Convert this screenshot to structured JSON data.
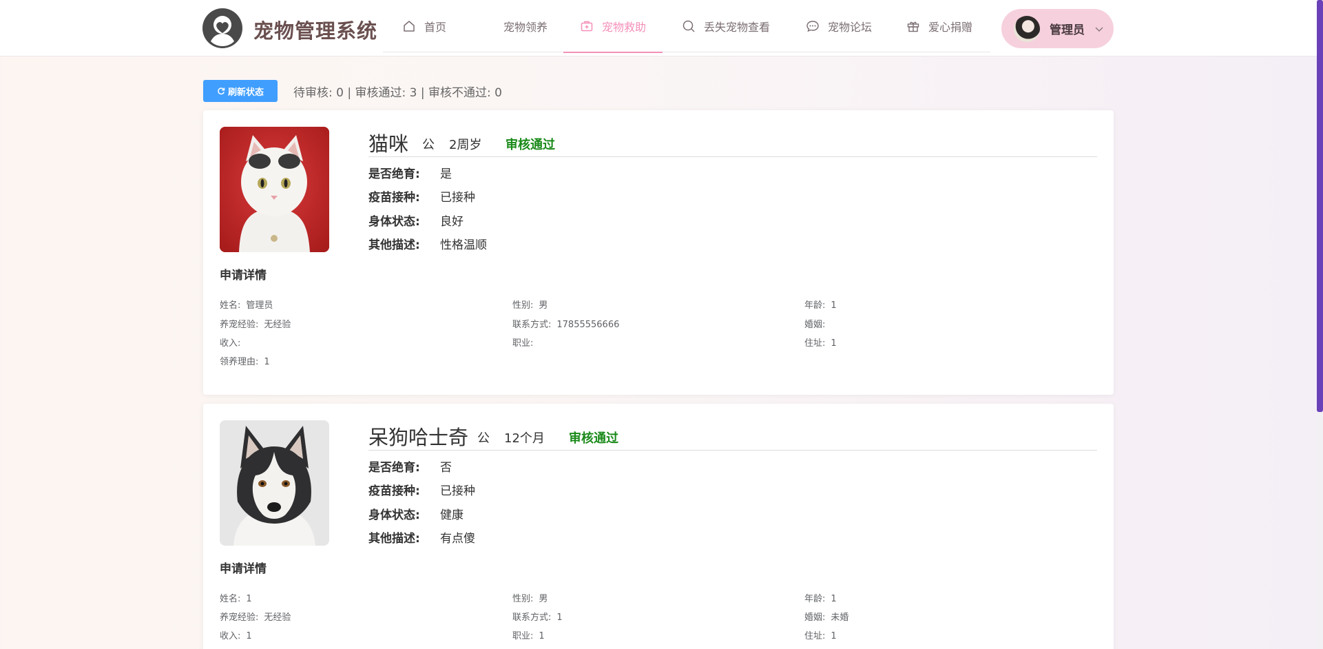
{
  "header": {
    "brand": "宠物管理系统",
    "nav": [
      {
        "label": "首页"
      },
      {
        "label": "宠物领养"
      },
      {
        "label": "宠物救助"
      },
      {
        "label": "丢失宠物查看"
      },
      {
        "label": "宠物论坛"
      },
      {
        "label": "爱心捐赠"
      }
    ],
    "active_nav": "宠物救助",
    "user_name": "管理员"
  },
  "toolbar": {
    "refresh_label": "刷新状态",
    "stats_text": "待审核: 0 | 审核通过: 3 | 审核不通过: 0"
  },
  "labels": {
    "sterilized": "是否绝育:",
    "vaccinated": "疫苗接种:",
    "health": "身体状态:",
    "other": "其他描述:",
    "apply_details": "申请详情",
    "name": "姓名:",
    "gender": "性别:",
    "age": "年龄:",
    "experience": "养宠经验:",
    "contact": "联系方式:",
    "marriage": "婚姻:",
    "income": "收入:",
    "job": "职业:",
    "address": "住址:",
    "reason": "领养理由:"
  },
  "cards": [
    {
      "pet_name": "猫咪",
      "sex": "公",
      "age": "2周岁",
      "status": "审核通过",
      "sterilized": "是",
      "vaccinated": "已接种",
      "health": "良好",
      "other": "性格温顺",
      "applicant": {
        "name": "管理员",
        "gender": "男",
        "age": "1",
        "experience": "无经验",
        "contact": "17855556666",
        "marriage": "",
        "income": "",
        "job": "",
        "address": "1",
        "reason": "1"
      }
    },
    {
      "pet_name": "呆狗哈士奇",
      "sex": "公",
      "age": "12个月",
      "status": "审核通过",
      "sterilized": "否",
      "vaccinated": "已接种",
      "health": "健康",
      "other": "有点傻",
      "applicant": {
        "name": "1",
        "gender": "男",
        "age": "1",
        "experience": "无经验",
        "contact": "1",
        "marriage": "未婚",
        "income": "1",
        "job": "1",
        "address": "1"
      }
    }
  ],
  "colors": {
    "accent_pink": "#f48fb8",
    "primary_blue": "#409eff",
    "status_green": "#1a8a1a",
    "scroll_thumb": "#6a41b8"
  }
}
